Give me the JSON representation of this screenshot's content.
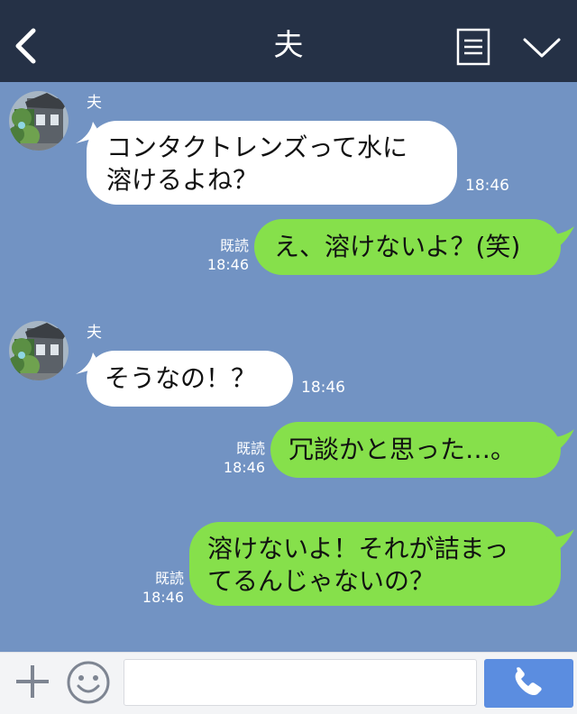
{
  "header": {
    "back_icon": "chevron-left-icon",
    "title": "夫",
    "menu_icon": "list-icon",
    "collapse_icon": "chevron-down-icon"
  },
  "messages": [
    {
      "direction": "in",
      "sender": "夫",
      "lines": [
        "コンタクトレンズって水に",
        "溶けるよね？"
      ],
      "time": "18:46"
    },
    {
      "direction": "out",
      "read": "既読",
      "lines": [
        "え、溶けないよ？(笑)"
      ],
      "time": "18:46"
    },
    {
      "direction": "in",
      "sender": "夫",
      "lines": [
        "そうなの！？"
      ],
      "time": "18:46"
    },
    {
      "direction": "out",
      "read": "既読",
      "lines": [
        "冗談かと思った…。"
      ],
      "time": "18:46"
    },
    {
      "direction": "out",
      "read": "既読",
      "lines": [
        "溶けないよ！それが詰まっ",
        "てるんじゃないの？"
      ],
      "time": "18:46"
    }
  ],
  "inputbar": {
    "plus_icon": "plus-icon",
    "emoji_icon": "smiley-icon",
    "input_value": "",
    "call_icon": "phone-icon"
  },
  "colors": {
    "header": "#253146",
    "chat_background": "#7293c3",
    "incoming_bubble": "#ffffff",
    "outgoing_bubble": "#86e04b",
    "call_button": "#5b8de0"
  }
}
